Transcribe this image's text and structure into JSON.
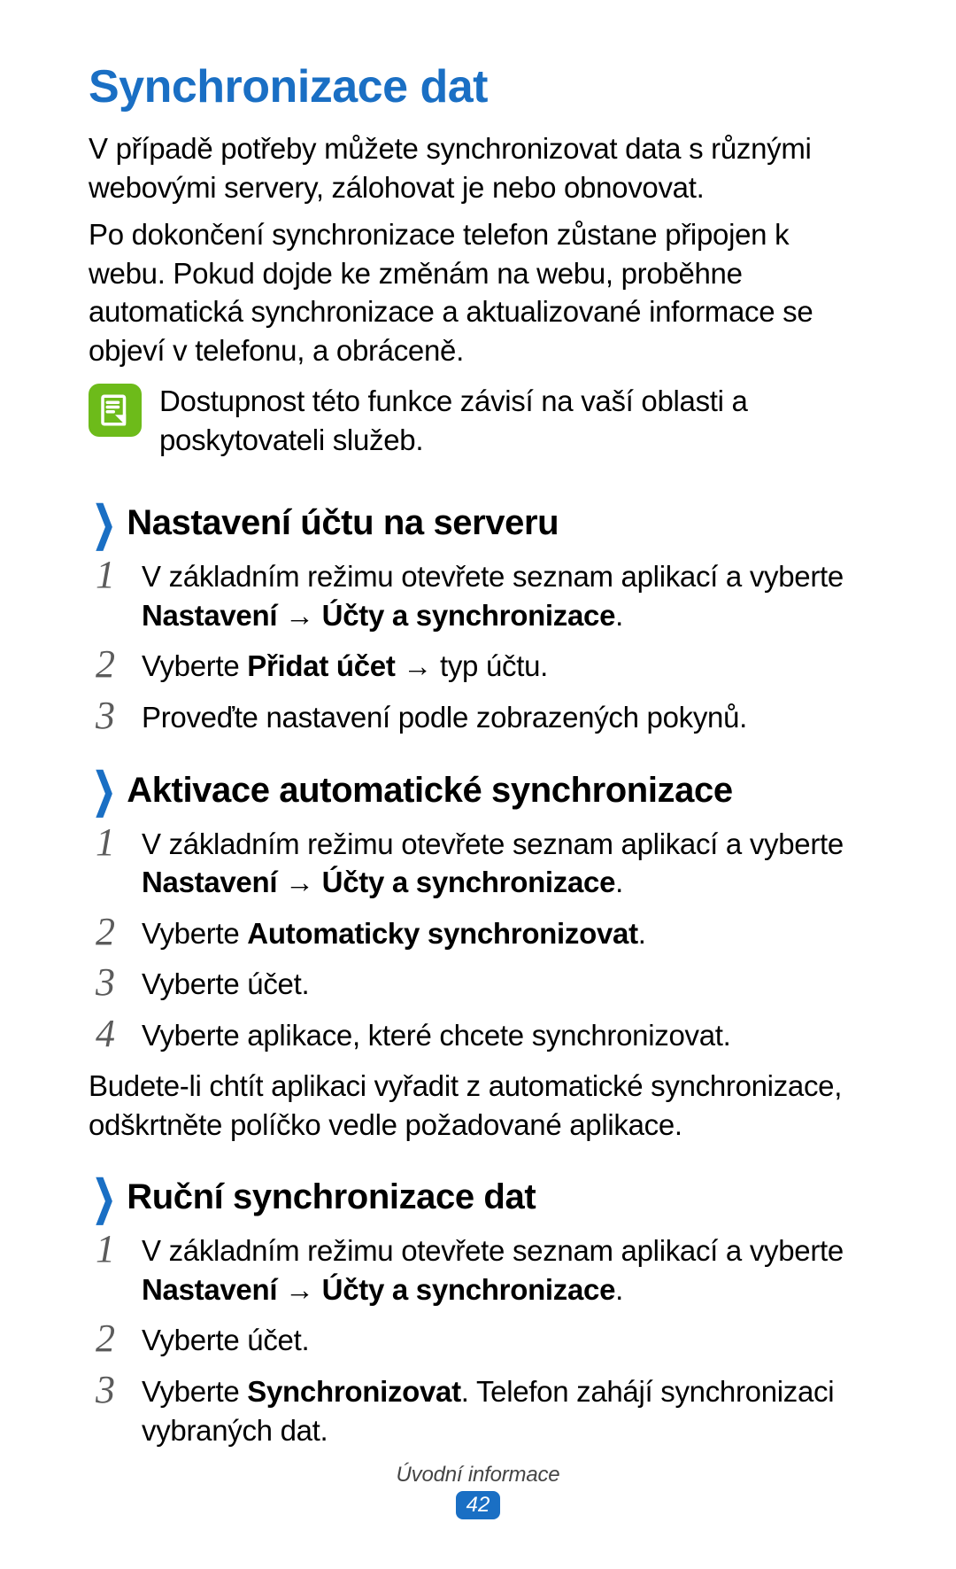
{
  "title": "Synchronizace dat",
  "intro": [
    "V případě potřeby můžete synchronizovat data s různými webovými servery, zálohovat je nebo obnovovat.",
    "Po dokončení synchronizace telefon zůstane připojen k webu. Pokud dojde ke změnám na webu, proběhne automatická synchronizace a aktualizované informace se objeví v telefonu, a obráceně."
  ],
  "note_icon": "note-icon",
  "note": "Dostupnost této funkce závisí na vaší oblasti a poskytovateli služeb.",
  "sections": [
    {
      "heading": "Nastavení účtu na serveru",
      "steps": [
        {
          "n": "1",
          "html": "V základním režimu otevřete seznam aplikací a vyberte <span class=\"b\">Nastavení</span> <span class=\"arrow\">→</span> <span class=\"b\">Účty a synchronizace</span>."
        },
        {
          "n": "2",
          "html": "Vyberte <span class=\"b\">Přidat účet</span> <span class=\"arrow\">→</span> typ účtu."
        },
        {
          "n": "3",
          "html": "Proveďte nastavení podle zobrazených pokynů."
        }
      ]
    },
    {
      "heading": "Aktivace automatické synchronizace",
      "steps": [
        {
          "n": "1",
          "html": "V základním režimu otevřete seznam aplikací a vyberte <span class=\"b\">Nastavení</span> <span class=\"arrow\">→</span> <span class=\"b\">Účty a synchronizace</span>."
        },
        {
          "n": "2",
          "html": "Vyberte <span class=\"b\">Automaticky synchronizovat</span>."
        },
        {
          "n": "3",
          "html": "Vyberte účet."
        },
        {
          "n": "4",
          "html": "Vyberte aplikace, které chcete synchronizovat."
        }
      ],
      "after": "Budete-li chtít aplikaci vyřadit z automatické synchronizace, odškrtněte políčko vedle požadované aplikace."
    },
    {
      "heading": "Ruční synchronizace dat",
      "steps": [
        {
          "n": "1",
          "html": "V základním režimu otevřete seznam aplikací a vyberte <span class=\"b\">Nastavení</span> <span class=\"arrow\">→</span> <span class=\"b\">Účty a synchronizace</span>."
        },
        {
          "n": "2",
          "html": "Vyberte účet."
        },
        {
          "n": "3",
          "html": "Vyberte <span class=\"b\">Synchronizovat</span>. Telefon zahájí synchronizaci vybraných dat."
        }
      ]
    }
  ],
  "footer_label": "Úvodní informace",
  "page_number": "42"
}
